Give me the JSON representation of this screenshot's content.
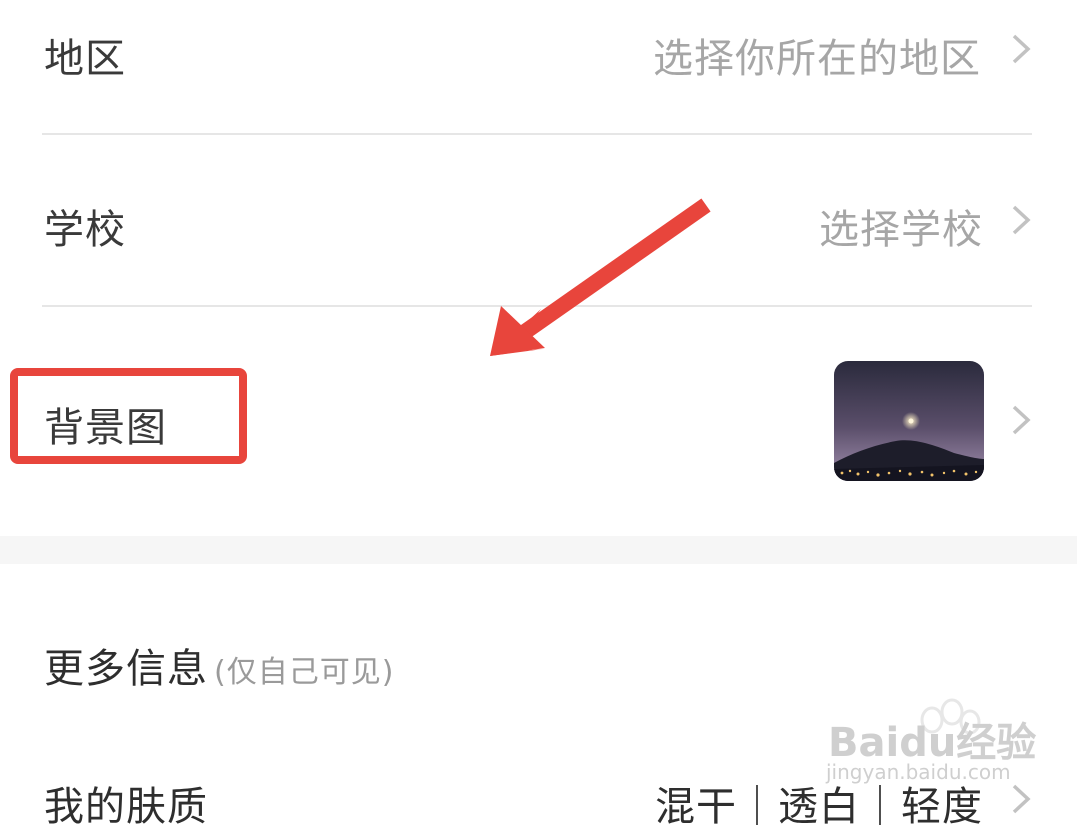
{
  "rows": {
    "region": {
      "label": "地区",
      "value": "选择你所在的地区"
    },
    "school": {
      "label": "学校",
      "value": "选择学校"
    },
    "background": {
      "label": "背景图"
    }
  },
  "more_info": {
    "title": "更多信息",
    "note": "(仅自己可见)"
  },
  "temperament": {
    "label": "我的肤质",
    "value": "混干｜透白｜轻度"
  },
  "watermark": {
    "brand": "Baidu经验",
    "url": "jingyan.baidu.com"
  },
  "colors": {
    "highlight": "#e8453c",
    "label": "#3a3a3a",
    "value": "#a6a6a6",
    "divider": "#e6e6e6"
  }
}
